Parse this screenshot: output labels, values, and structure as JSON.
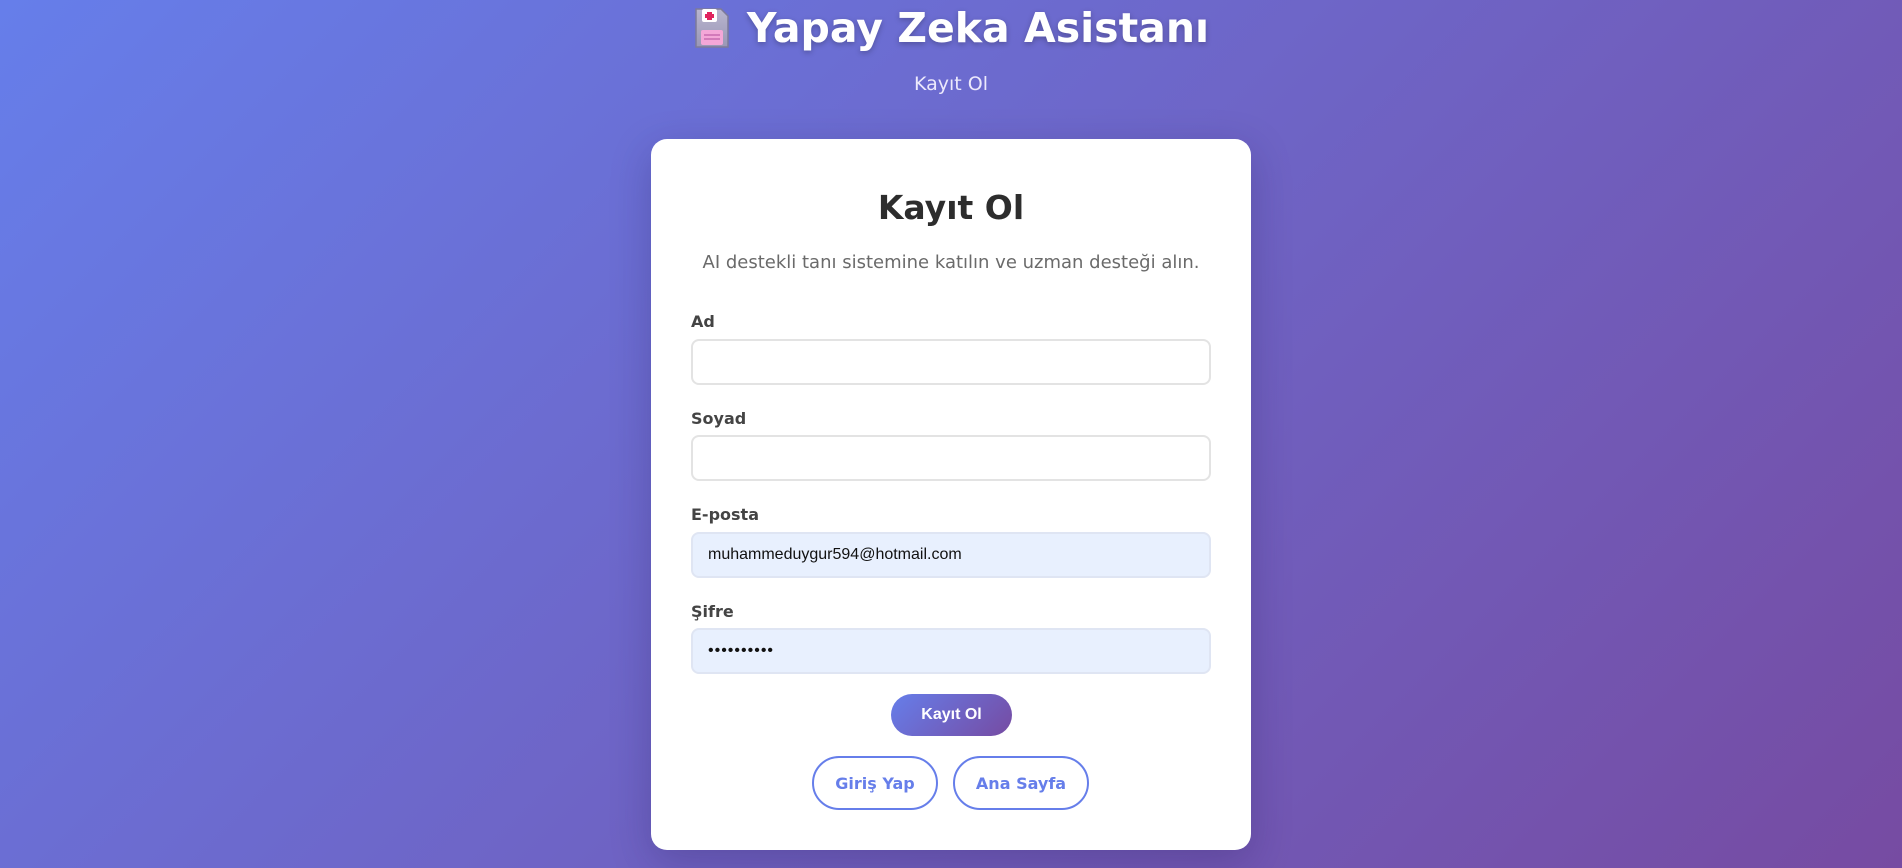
{
  "header": {
    "logo_icon": "hospital-floppy-icon",
    "title": "Yapay Zeka Asistanı",
    "subtitle": "Kayıt Ol"
  },
  "form": {
    "title": "Kayıt Ol",
    "description": "AI destekli tanı sistemine katılın ve uzman desteği alın.",
    "fields": {
      "first_name": {
        "label": "Ad",
        "value": ""
      },
      "last_name": {
        "label": "Soyad",
        "value": ""
      },
      "email": {
        "label": "E-posta",
        "value": "muhammeduygur594@hotmail.com"
      },
      "password": {
        "label": "Şifre",
        "value": "••••••••••"
      }
    },
    "submit_label": "Kayıt Ol"
  },
  "links": {
    "login_label": "Giriş Yap",
    "home_label": "Ana Sayfa"
  },
  "colors": {
    "gradient_start": "#667eea",
    "gradient_end": "#764ba2",
    "autofill_bg": "#e8f0fe"
  }
}
